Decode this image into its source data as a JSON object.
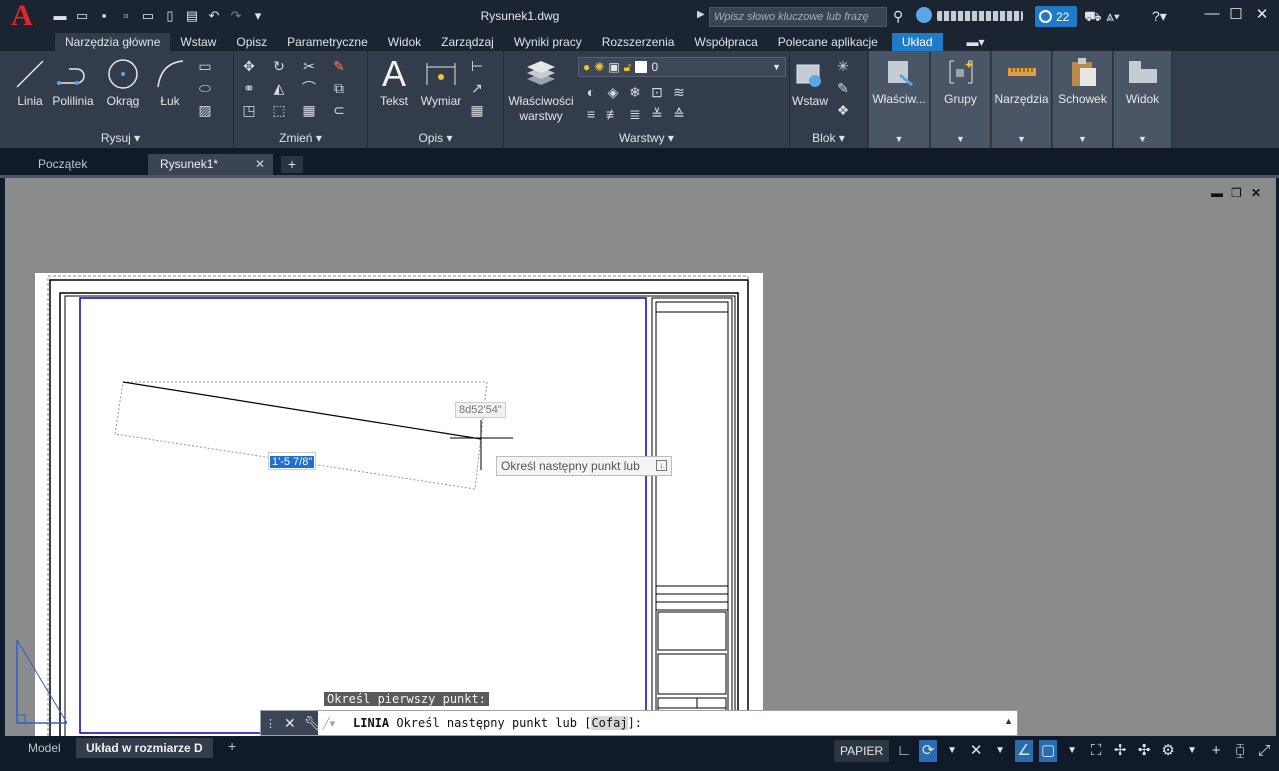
{
  "app": {
    "logo": "A",
    "doc_title": "Rysunek1.dwg",
    "search_placeholder": "Wpisz słowo kluczowe lub frazę",
    "user_name": "",
    "notifications_count": "22"
  },
  "ribbon_tabs": [
    {
      "label": "Narzędzia główne"
    },
    {
      "label": "Wstaw"
    },
    {
      "label": "Opisz"
    },
    {
      "label": "Parametryczne"
    },
    {
      "label": "Widok"
    },
    {
      "label": "Zarządzaj"
    },
    {
      "label": "Wyniki pracy"
    },
    {
      "label": "Rozszerzenia"
    },
    {
      "label": "Współpraca"
    },
    {
      "label": "Polecane aplikacje"
    },
    {
      "label": "Układ"
    }
  ],
  "panels": {
    "draw": {
      "title": "Rysuj",
      "tools": [
        "Linia",
        "Polilinia",
        "Okrąg",
        "Łuk"
      ]
    },
    "modify": {
      "title": "Zmień"
    },
    "annotate": {
      "title": "Opis",
      "tools": [
        "Tekst",
        "Wymiar"
      ]
    },
    "layers": {
      "title": "Warstwy",
      "tool": "Właściwości warstwy",
      "tool_line1": "Właściwości",
      "tool_line2": "warstwy",
      "current_layer": "0"
    },
    "block": {
      "title": "Blok",
      "tool": "Wstaw"
    },
    "tiles": [
      "Właściw...",
      "Grupy",
      "Narzędzia",
      "Schowek",
      "Widok"
    ]
  },
  "doc_tabs": [
    {
      "label": "Początek"
    },
    {
      "label": "Rysunek1*"
    }
  ],
  "canvas": {
    "angle_tooltip": "8d52'54\"",
    "length_input": "1'-5 7/8\"",
    "prompt_tooltip": "Określ następny punkt lub",
    "first_point_prompt": "Określ pierwszy punkt:"
  },
  "command_line": {
    "command": "LINIA",
    "prompt": "Określ następny punkt lub [",
    "option": "Cofaj",
    "suffix": "]:"
  },
  "status": {
    "layout_tabs": [
      "Model",
      "Układ w rozmiarze D"
    ],
    "space": "PAPIER"
  },
  "colors": {
    "accent": "#1f7ac7",
    "logo_red": "#e0262a",
    "viewport_border": "#0000cc",
    "canvas_bg": "#8a8b8c"
  }
}
